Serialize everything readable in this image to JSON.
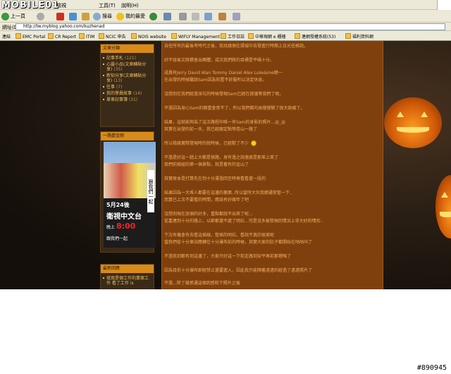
{
  "logo": "MOBILE01",
  "menu": {
    "edit": "檢視",
    "tools": "工具(T)",
    "help": "說明(H)"
  },
  "toolbar": {
    "back": "上一頁",
    "search": "搜尋",
    "favorites": "我的最愛"
  },
  "address": {
    "label": "網址(D)",
    "url": "http://tw.myblog.yahoo.com/kuzhenad"
  },
  "links": [
    "連結",
    "EMC Portal",
    "CR Report",
    "ITIM",
    "NCIC 申告",
    "NOIS website",
    "WIFLY Management",
    "工作日誌",
    "中華現網 e 櫃檯",
    "連網授權系統(53)",
    "福利資料網"
  ],
  "sidebar": {
    "categories_title": "文章分類",
    "categories": [
      {
        "label": "記事手札",
        "count": "(121)"
      },
      {
        "label": "心靈小品(文章轉貼分享)",
        "count": "(35)"
      },
      {
        "label": "新知分享(文章轉貼分享)",
        "count": "(13)"
      },
      {
        "label": "往事",
        "count": "(7)"
      },
      {
        "label": "我的學員故事",
        "count": "(14)"
      },
      {
        "label": "單車記事簿",
        "count": "(31)"
      }
    ],
    "event_title": "一路慶金剛",
    "banner": {
      "date": "5月24後",
      "channel": "衛視中文台",
      "time_prefix": "晚上",
      "time": "8:00",
      "bottom": "跟我們一起",
      "side": "跟我們一起"
    },
    "recent_title": "最新回應",
    "recent": [
      {
        "label": "填寫是個工作的業案工作 看了工作 is"
      }
    ]
  },
  "main": {
    "lines": [
      "自任所有的最後考時代之後，我找幾個在環城中去發進行時期上日光任務說。",
      "好不容易又將鑽會出團體，成次我們將的目標是平碼十分。",
      "成員有Jerry David Alan Tommy Daniel Alex Luke&me總一",
      "在出發的時候聽說Sam因為前置不舒服所以決定休息。",
      "沒想到在我們經過深坑的時候發現Sam已經在那邊等我們了呢。",
      "不過因為身心Sam的都重會意不了，所以我們都句由慢慢騎了很大勁幾了。",
      "結果，這就能夠為了這次路程中唯一有Sam的身影的照片...@_@",
      "其實在出發的前一天，我已經跟定點等卷山一路了",
      "所以隨幾實際發現時的就時候，已經默了不少",
      "不過是好這一趟上大都是很路，身有過之說速度是那差上來了",
      "我們前兩組的第一個景點，就是著有的金山了",
      "其實原本是打算先在到十分運過回至時再看看還一段的",
      "結果因為一大堆人都要在這邊的裏面..所以當所大伙我網通常管一下..",
      "而算已上次不要看的時間，應該有好幾年了吧",
      "沒想到現在放個的好多，重點都說不出來了呢...",
      "從嘉連到十分的路上，以節都還不處了明石...可是沒多被發現的情況上非大好的情形..",
      "下次有機會有去看這條線，整條的明石，看說不真的很美呢",
      "當我們從十分車站應轉往十分瀑布前的時候，其實大家的肚子都開始在咕咕叫了",
      "不過我到都有到這邊了，大家只好這一下前走路到安平再前那裡嗎了",
      "因為目前十分瀑布即經禁止還要進入，因此我只能隔著遠遠的經過了遠遠照片了",
      "不過...除了幾張通這個到感和下照片之後"
    ]
  },
  "watermark": "#890945"
}
